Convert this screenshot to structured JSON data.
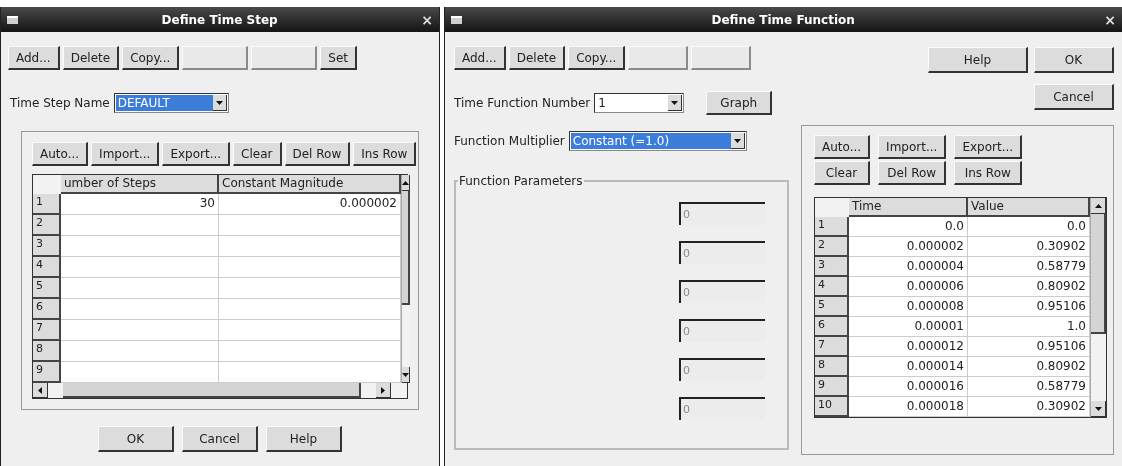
{
  "time_step_window": {
    "title": "Define Time Step",
    "close_glyph": "×",
    "toolbar": [
      {
        "label": "Add...",
        "disabled": false
      },
      {
        "label": "Delete",
        "disabled": false
      },
      {
        "label": "Copy...",
        "disabled": false
      },
      {
        "disabled": true
      },
      {
        "disabled": true
      },
      {
        "label": "Set",
        "disabled": false
      }
    ],
    "name_label": "Time Step Name",
    "name_value": "DEFAULT",
    "name_highlighted": true,
    "table_buttons": [
      "Auto...",
      "Import...",
      "Export...",
      "Clear",
      "Del Row",
      "Ins Row"
    ],
    "table": {
      "columns": [
        "umber of Steps",
        "Constant Magnitude"
      ],
      "rows": [
        {
          "number": "1",
          "cells": [
            "30",
            "0.000002"
          ]
        },
        {
          "number": "2"
        },
        {
          "number": "3"
        },
        {
          "number": "4"
        },
        {
          "number": "5"
        },
        {
          "number": "6"
        },
        {
          "number": "7"
        },
        {
          "number": "8"
        },
        {
          "number": "9"
        }
      ]
    },
    "buttons": [
      "OK",
      "Cancel",
      "Help"
    ]
  },
  "time_function_window": {
    "title": "Define Time Function",
    "close_glyph": "×",
    "toolbar": [
      {
        "label": "Add...",
        "disabled": false
      },
      {
        "label": "Delete",
        "disabled": false
      },
      {
        "label": "Copy...",
        "disabled": false
      },
      {
        "disabled": true
      },
      {
        "disabled": true
      }
    ],
    "side_buttons": [
      "Help",
      "OK",
      "Cancel"
    ],
    "number_label": "Time Function Number",
    "number_value": "1",
    "graph_button": "Graph",
    "multiplier_label": "Function Multiplier",
    "multiplier_value": "Constant (=1.0)",
    "multiplier_highlighted": true,
    "group_title": "Function Parameters",
    "params": [
      {
        "value": "0",
        "disabled": true
      },
      {
        "value": "0",
        "disabled": true
      },
      {
        "value": "0",
        "disabled": true
      },
      {
        "value": "0",
        "disabled": true
      },
      {
        "value": "0",
        "disabled": true
      },
      {
        "value": "0",
        "disabled": true
      }
    ],
    "table_buttons": [
      "Auto...",
      "Import...",
      "Export...",
      "Clear",
      "Del Row",
      "Ins Row"
    ],
    "table": {
      "columns": [
        "Time",
        "Value"
      ],
      "rows": [
        {
          "number": "1",
          "cells": [
            "0.0",
            "0.0"
          ]
        },
        {
          "number": "2",
          "cells": [
            "0.000002",
            "0.30902"
          ]
        },
        {
          "number": "3",
          "cells": [
            "0.000004",
            "0.58779"
          ]
        },
        {
          "number": "4",
          "cells": [
            "0.000006",
            "0.80902"
          ]
        },
        {
          "number": "5",
          "cells": [
            "0.000008",
            "0.95106"
          ]
        },
        {
          "number": "6",
          "cells": [
            "0.00001",
            "1.0"
          ]
        },
        {
          "number": "7",
          "cells": [
            "0.000012",
            "0.95106"
          ]
        },
        {
          "number": "8",
          "cells": [
            "0.000014",
            "0.80902"
          ]
        },
        {
          "number": "9",
          "cells": [
            "0.000016",
            "0.58779"
          ]
        },
        {
          "number": "10",
          "cells": [
            "0.000018",
            "0.30902"
          ]
        }
      ]
    }
  }
}
